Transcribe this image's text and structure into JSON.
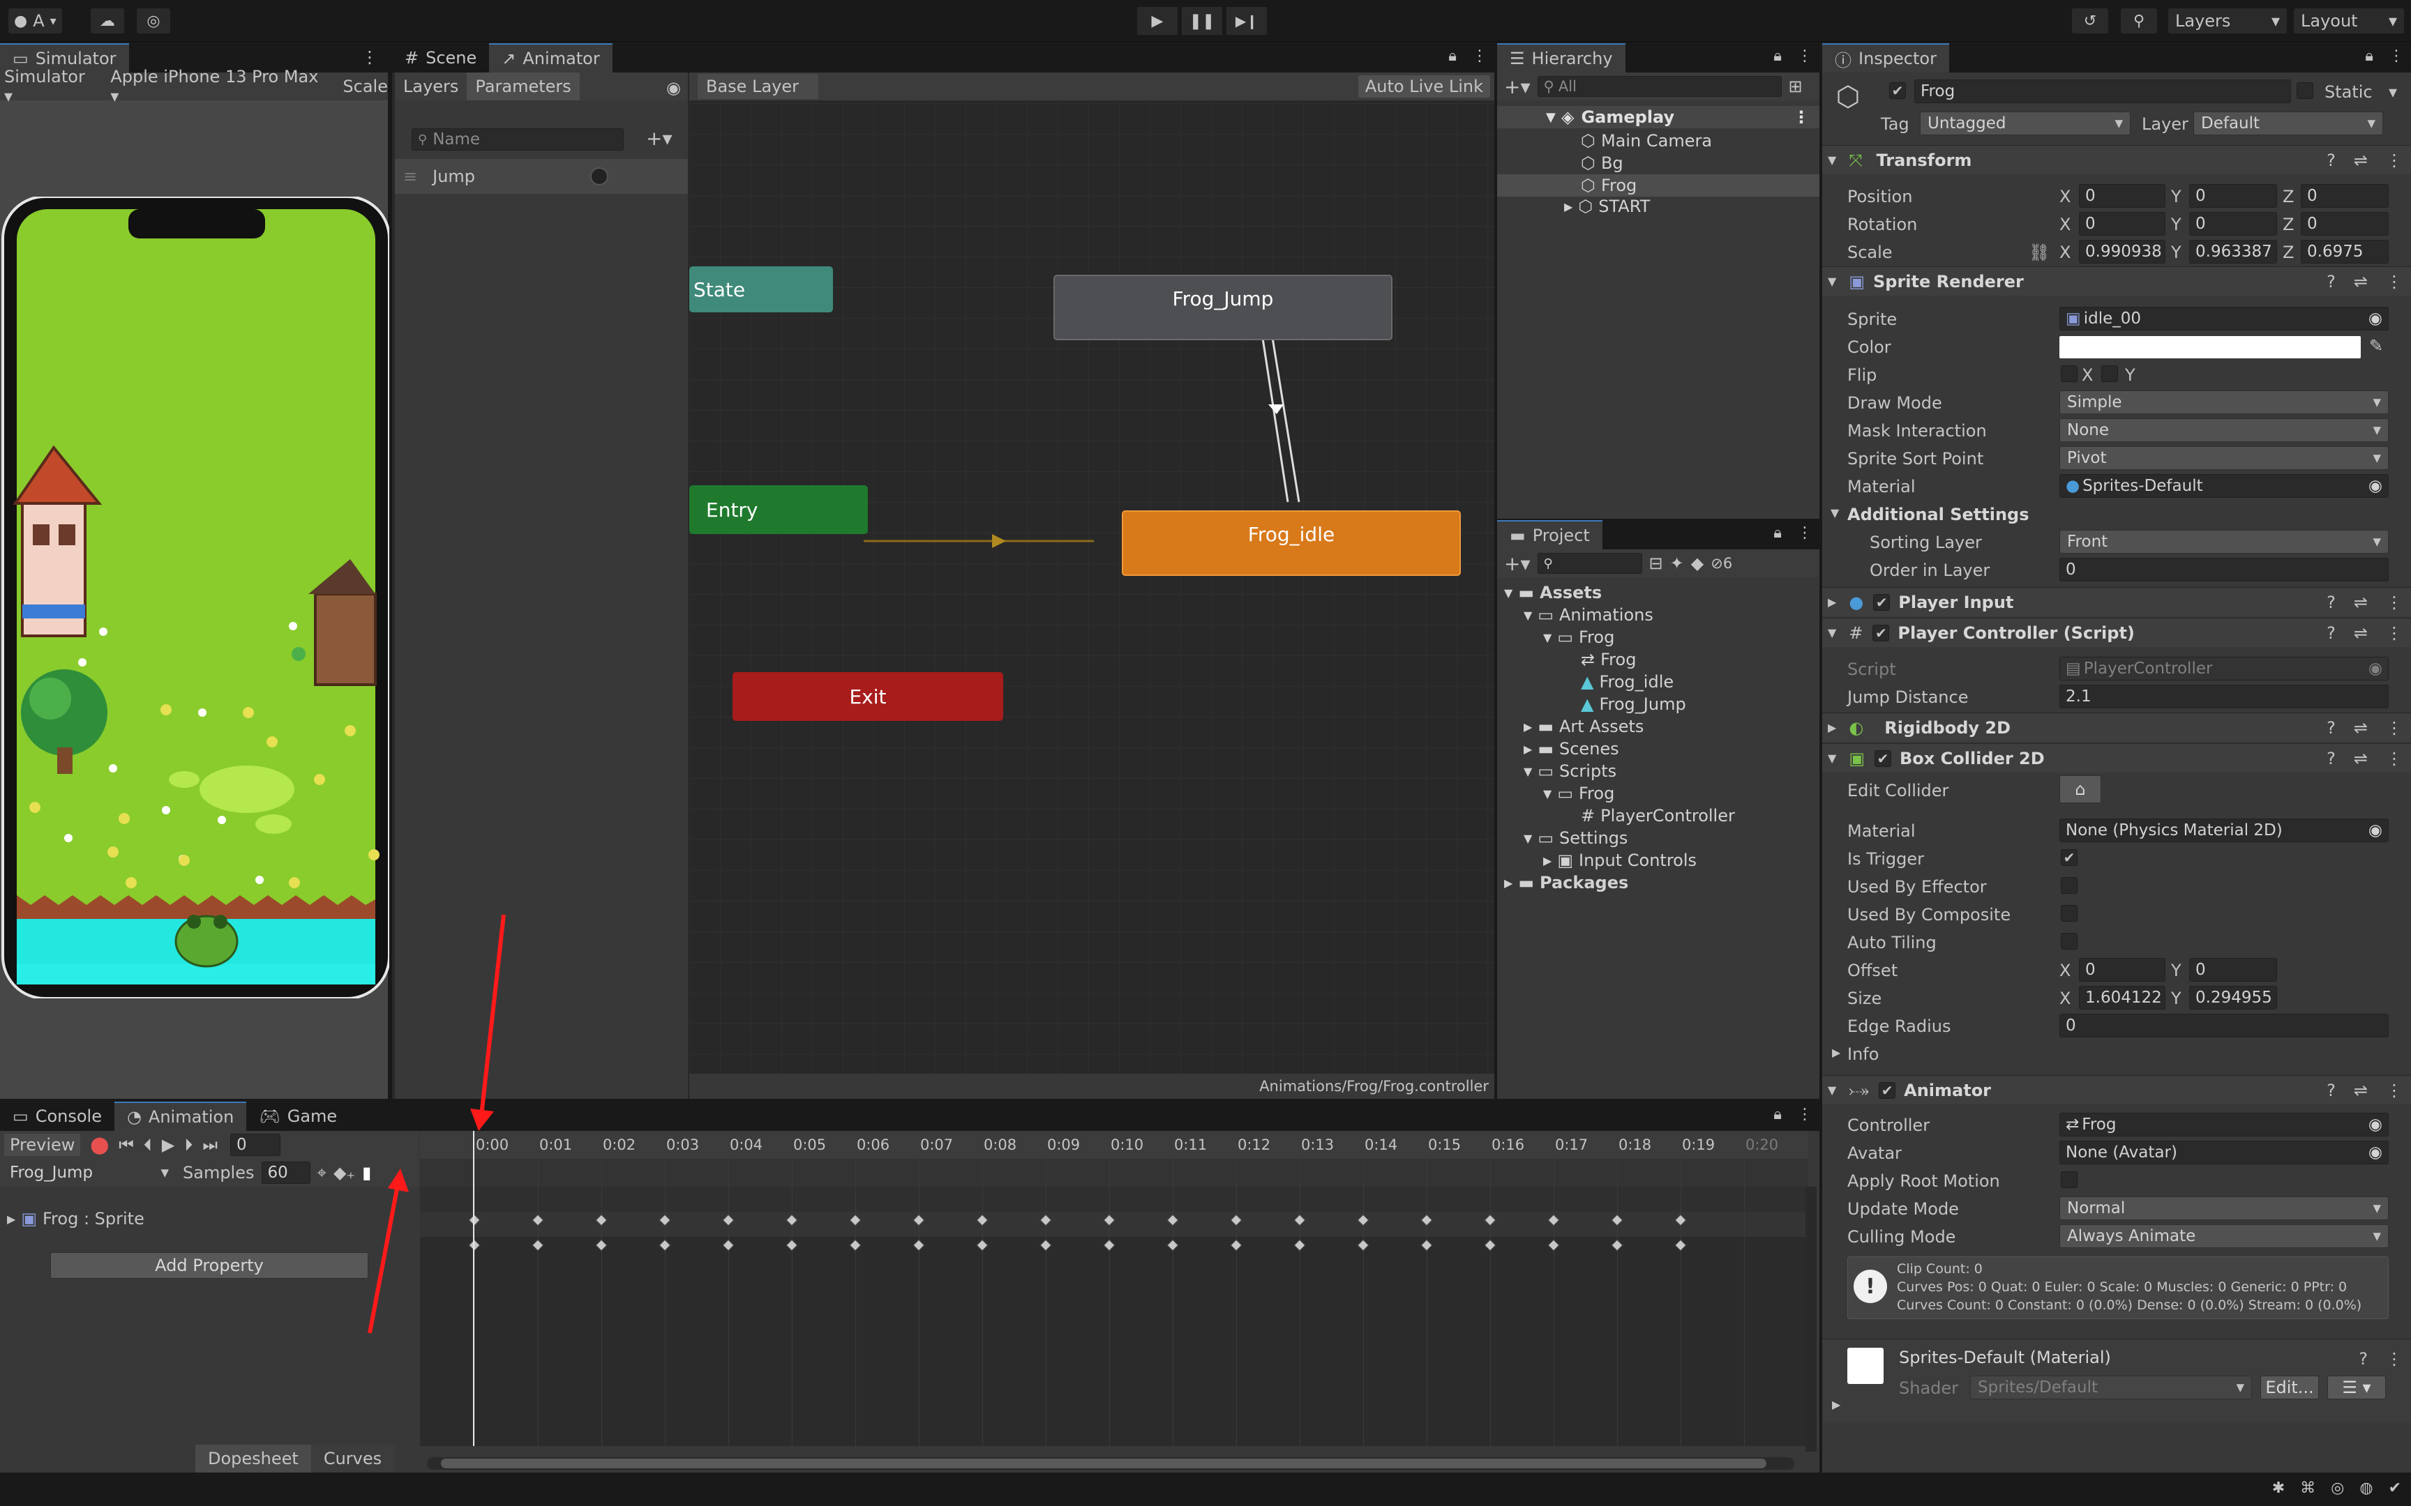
{
  "toolbar": {
    "account": "A",
    "layers": "Layers",
    "layout": "Layout"
  },
  "simulator": {
    "tab": "Simulator",
    "mode": "Simulator",
    "device": "Apple iPhone 13 Pro Max",
    "scale": "Scale"
  },
  "scene_tabs": {
    "scene": "Scene",
    "animator": "Animator"
  },
  "animator": {
    "tab_layers": "Layers",
    "tab_parameters": "Parameters",
    "search_placeholder": "Name",
    "param": "Jump",
    "breadcrumb": "Base Layer",
    "auto_live_link": "Auto Live Link",
    "footer_path": "Animations/Frog/Frog.controller",
    "nodes": {
      "any_state": "State",
      "entry": "Entry",
      "exit": "Exit",
      "frog_jump": "Frog_Jump",
      "frog_idle": "Frog_idle"
    }
  },
  "hierarchy": {
    "tab": "Hierarchy",
    "search_placeholder": "All",
    "scene": "Gameplay",
    "items": [
      "Main Camera",
      "Bg",
      "Frog",
      "START"
    ]
  },
  "project": {
    "tab": "Project",
    "count": "6",
    "tree": [
      "Assets",
      "Animations",
      "Frog",
      "Frog",
      "Frog_idle",
      "Frog_Jump",
      "Art Assets",
      "Scenes",
      "Scripts",
      "Frog",
      "PlayerController",
      "Settings",
      "Input Controls",
      "Packages"
    ]
  },
  "inspector": {
    "tab": "Inspector",
    "object_name": "Frog",
    "static_label": "Static",
    "tag_label": "Tag",
    "tag_value": "Untagged",
    "layer_label": "Layer",
    "layer_value": "Default",
    "transform": {
      "title": "Transform",
      "position": "Position",
      "rotation": "Rotation",
      "scale": "Scale",
      "pos": [
        "0",
        "0",
        "0"
      ],
      "rot": [
        "0",
        "0",
        "0"
      ],
      "scl": [
        "0.990938",
        "0.963387",
        "0.6975"
      ]
    },
    "sprite_renderer": {
      "title": "Sprite Renderer",
      "sprite": "Sprite",
      "sprite_value": "idle_00",
      "color": "Color",
      "flip": "Flip",
      "draw_mode": "Draw Mode",
      "draw_mode_value": "Simple",
      "mask": "Mask Interaction",
      "mask_value": "None",
      "sort_point": "Sprite Sort Point",
      "sort_point_value": "Pivot",
      "material": "Material",
      "material_value": "Sprites-Default",
      "additional": "Additional Settings",
      "sorting_layer": "Sorting Layer",
      "sorting_layer_value": "Front",
      "order": "Order in Layer",
      "order_value": "0"
    },
    "player_input": {
      "title": "Player Input"
    },
    "player_controller": {
      "title": "Player Controller (Script)",
      "script": "Script",
      "script_value": "PlayerController",
      "jump": "Jump Distance",
      "jump_value": "2.1"
    },
    "rigidbody": {
      "title": "Rigidbody 2D"
    },
    "box_collider": {
      "title": "Box Collider 2D",
      "edit": "Edit Collider",
      "material": "Material",
      "material_value": "None (Physics Material 2D)",
      "is_trigger": "Is Trigger",
      "used_by_effector": "Used By Effector",
      "used_by_composite": "Used By Composite",
      "auto_tiling": "Auto Tiling",
      "offset": "Offset",
      "offset_x": "0",
      "offset_y": "0",
      "size": "Size",
      "size_x": "1.604122",
      "size_y": "0.294955",
      "edge_radius": "Edge Radius",
      "edge_radius_value": "0",
      "info": "Info"
    },
    "animator": {
      "title": "Animator",
      "controller": "Controller",
      "controller_value": "Frog",
      "avatar": "Avatar",
      "avatar_value": "None (Avatar)",
      "apply_root": "Apply Root Motion",
      "update_mode": "Update Mode",
      "update_mode_value": "Normal",
      "culling": "Culling Mode",
      "culling_value": "Always Animate",
      "info1": "Clip Count: 0",
      "info2": "Curves Pos: 0 Quat: 0 Euler: 0 Scale: 0 Muscles: 0 Generic: 0 PPtr: 0",
      "info3": "Curves Count: 0 Constant: 0 (0.0%) Dense: 0 (0.0%) Stream: 0 (0.0%)"
    },
    "material_block": {
      "title": "Sprites-Default (Material)",
      "shader": "Shader",
      "shader_value": "Sprites/Default",
      "edit": "Edit..."
    }
  },
  "bottom": {
    "tab_console": "Console",
    "tab_animation": "Animation",
    "tab_game": "Game",
    "preview": "Preview",
    "frame": "0",
    "clip": "Frog_Jump",
    "samples_label": "Samples",
    "samples": "60",
    "property": "Frog : Sprite",
    "add_property": "Add Property",
    "dopesheet": "Dopesheet",
    "curves": "Curves",
    "ticks": [
      "0:00",
      "0:01",
      "0:02",
      "0:03",
      "0:04",
      "0:05",
      "0:06",
      "0:07",
      "0:08",
      "0:09",
      "0:10",
      "0:11",
      "0:12",
      "0:13",
      "0:14",
      "0:15",
      "0:16",
      "0:17",
      "0:18",
      "0:19",
      "0:20"
    ]
  }
}
